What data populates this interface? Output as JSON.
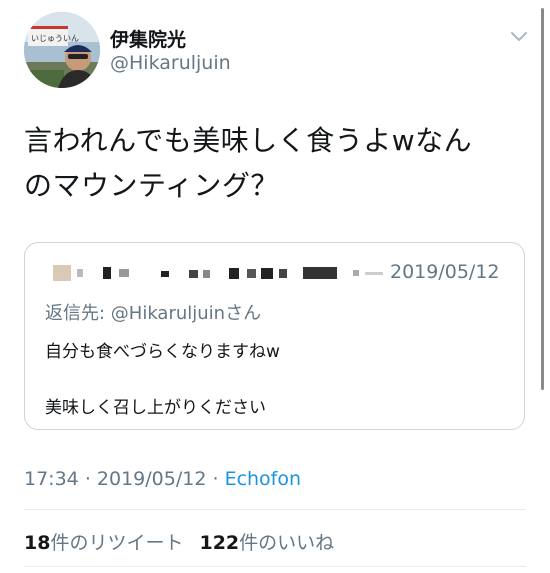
{
  "author": {
    "name": "伊集院光",
    "handle": "@Hikaruljuin"
  },
  "tweet": {
    "text_line1": "言われんでも美味しく食うよwなん",
    "text_line2": "のマウンティング？"
  },
  "quoted_tweet": {
    "date": "2019/05/12",
    "reply_to": "返信先: @Hikaruljuinさん",
    "line1": "自分も食べづらくなりますねw",
    "line2": "美味しく召し上がりください"
  },
  "meta": {
    "time": "17:34",
    "separator": "·",
    "date": "2019/05/12",
    "source": "Echofon"
  },
  "stats": {
    "retweet_count": "18",
    "retweet_label": "件のリツイート",
    "like_count": "122",
    "like_label": "件のいいね"
  },
  "colors": {
    "text": "#14171a",
    "secondary": "#657786",
    "link": "#1b95e0",
    "border": "#ccd6dd"
  },
  "icons": {
    "menu": "chevron-down-icon"
  }
}
